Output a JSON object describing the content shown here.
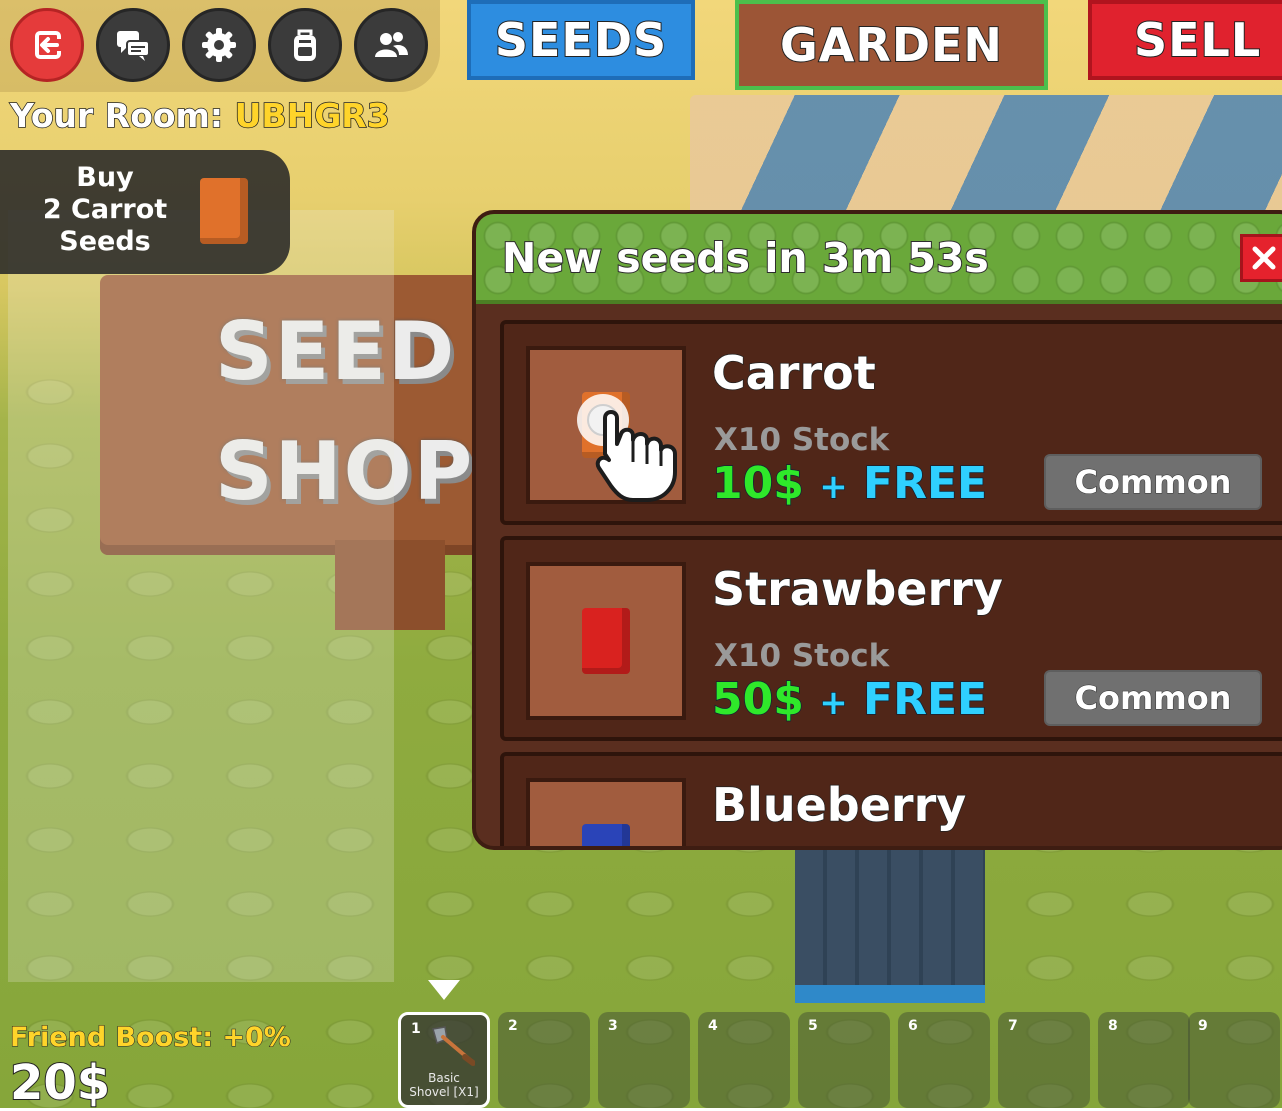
{
  "top_buttons": [
    {
      "icon": "exit-icon",
      "color": "#e53b3b"
    },
    {
      "icon": "chat-icon",
      "color": "#3b3b3b"
    },
    {
      "icon": "gear-icon",
      "color": "#3b3b3b"
    },
    {
      "icon": "backpack-icon",
      "color": "#3b3b3b"
    },
    {
      "icon": "friends-icon",
      "color": "#3b3b3b"
    }
  ],
  "room": {
    "label": "Your Room:",
    "code": "UBHGR3"
  },
  "tabs": {
    "seeds": "SEEDS",
    "garden": "GARDEN",
    "sell": "SELL"
  },
  "buy_quick": {
    "line1": "Buy",
    "line2": "2 Carrot",
    "line3": "Seeds"
  },
  "shop": {
    "timer_text": "New seeds in 3m 53s",
    "items": [
      {
        "name": "Carrot",
        "stock": "X10 Stock",
        "price": "10$",
        "plus": "+",
        "free": "FREE",
        "rarity": "Common",
        "color": "#e0712b"
      },
      {
        "name": "Strawberry",
        "stock": "X10 Stock",
        "price": "50$",
        "plus": "+",
        "free": "FREE",
        "rarity": "Common",
        "color": "#d9221f"
      },
      {
        "name": "Blueberry",
        "color": "#2a44b8"
      }
    ]
  },
  "status": {
    "friend_boost": "Friend Boost: +0%",
    "money": "20$"
  },
  "hotbar": {
    "selected_index": 1,
    "slots": [
      {
        "num": "1",
        "label_line1": "Basic",
        "label_line2": "Shovel [X1]",
        "icon": "shovel-icon"
      },
      {
        "num": "2"
      },
      {
        "num": "3"
      },
      {
        "num": "4"
      },
      {
        "num": "5"
      },
      {
        "num": "6"
      },
      {
        "num": "7"
      },
      {
        "num": "8"
      },
      {
        "num": "9"
      }
    ]
  },
  "world_sign": {
    "line1": "SEED",
    "line2": "SHOP"
  }
}
